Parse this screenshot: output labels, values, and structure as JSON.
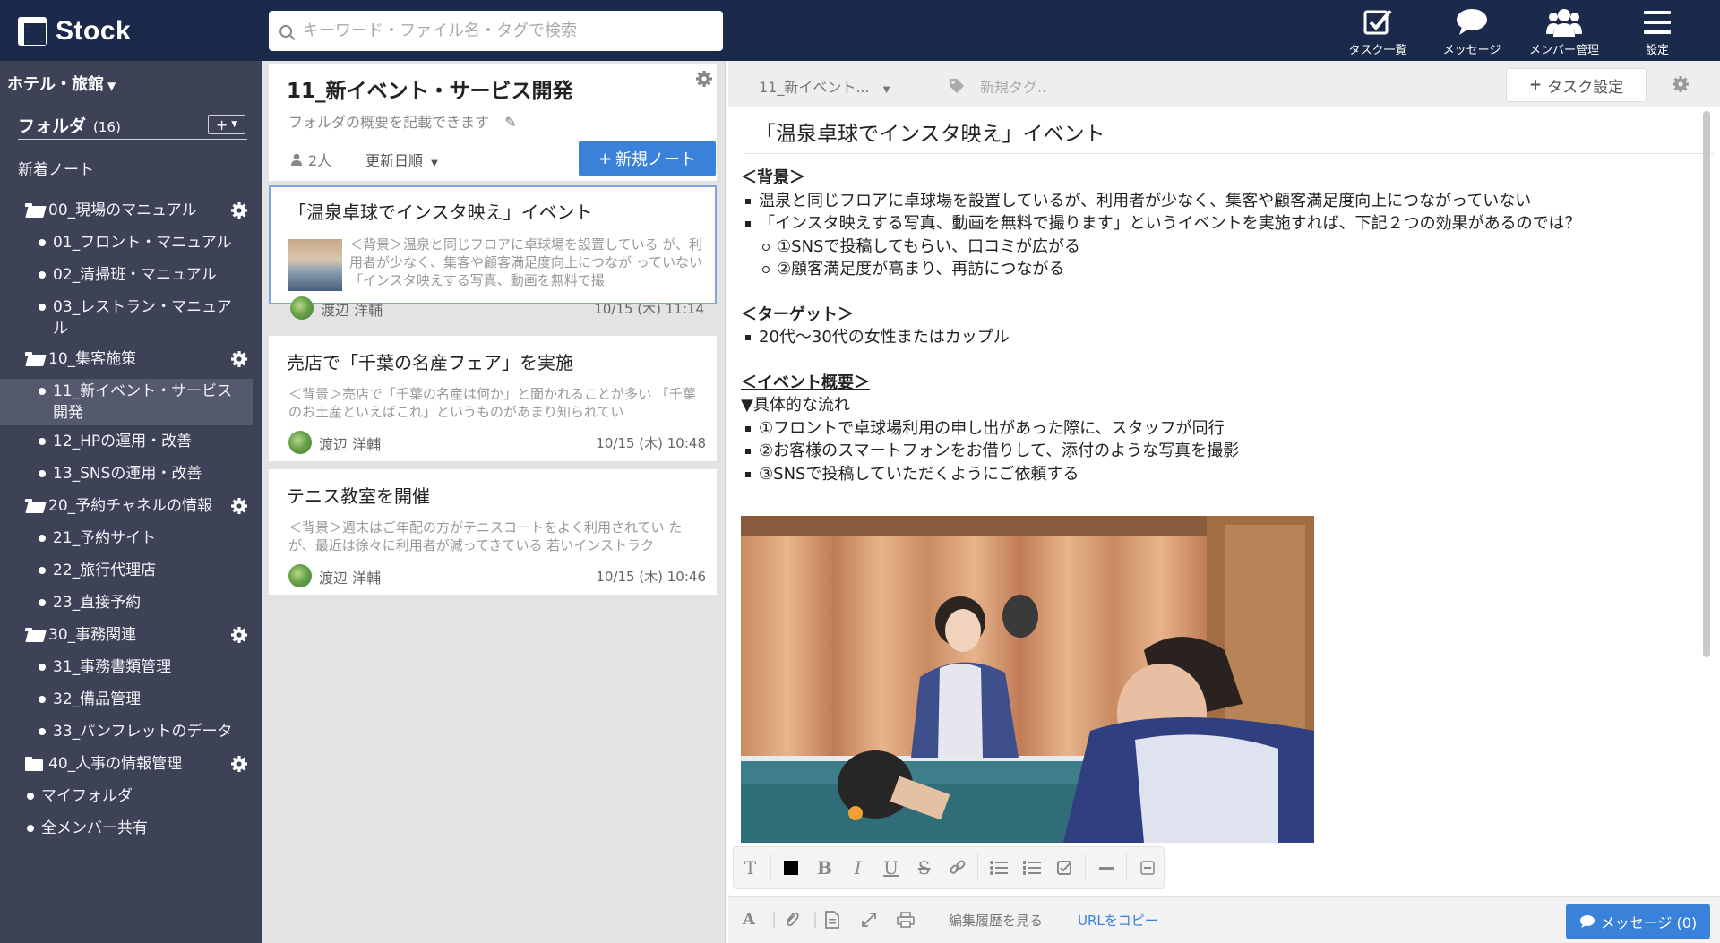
{
  "app": {
    "logo_text": "Stock",
    "brand_color": "#1b2a4a",
    "accent_color": "#3a82d9"
  },
  "search": {
    "placeholder": "キーワード・ファイル名・タグで検索"
  },
  "topnav": [
    {
      "label": "タスク一覧",
      "icon": "checkbox-icon"
    },
    {
      "label": "メッセージ",
      "icon": "speech-bubble-icon"
    },
    {
      "label": "メンバー管理",
      "icon": "members-icon"
    },
    {
      "label": "設定",
      "icon": "hamburger-icon"
    }
  ],
  "sidebar": {
    "company": "ホテル・旅館",
    "folder_header": "フォルダ",
    "folder_count": "(16)",
    "new_notes": "新着ノート",
    "items": [
      {
        "label": "00_現場のマニュアル",
        "type": "folder-open"
      },
      {
        "label": "01_フロント・マニュアル",
        "type": "sub"
      },
      {
        "label": "02_清掃班・マニュアル",
        "type": "sub"
      },
      {
        "label": "03_レストラン・マニュアル",
        "type": "sub"
      },
      {
        "label": "10_集客施策",
        "type": "folder-open"
      },
      {
        "label": "11_新イベント・サービス開発",
        "type": "sub",
        "selected": true
      },
      {
        "label": "12_HPの運用・改善",
        "type": "sub"
      },
      {
        "label": "13_SNSの運用・改善",
        "type": "sub"
      },
      {
        "label": "20_予約チャネルの情報",
        "type": "folder-open"
      },
      {
        "label": "21_予約サイト",
        "type": "sub"
      },
      {
        "label": "22_旅行代理店",
        "type": "sub"
      },
      {
        "label": "23_直接予約",
        "type": "sub"
      },
      {
        "label": "30_事務関連",
        "type": "folder-open"
      },
      {
        "label": "31_事務書類管理",
        "type": "sub"
      },
      {
        "label": "32_備品管理",
        "type": "sub"
      },
      {
        "label": "33_パンフレットのデータ",
        "type": "sub"
      },
      {
        "label": "40_人事の情報管理",
        "type": "folder-closed"
      },
      {
        "label": "マイフォルダ",
        "type": "root"
      },
      {
        "label": "全メンバー共有",
        "type": "root"
      }
    ]
  },
  "list": {
    "folder_title": "11_新イベント・サービス開発",
    "folder_desc": "フォルダの概要を記載できます",
    "members": "2人",
    "sort": "更新日順",
    "new_note": "新規ノート",
    "notes": [
      {
        "title": "「温泉卓球でインスタ映え」イベント",
        "snippet": "＜背景＞温泉と同じフロアに卓球場を設置している が、利用者が少なく、集客や顧客満足度向上につなが っていない 「インスタ映えする写真、動画を無料で撮",
        "author": "渡辺 洋輔",
        "date": "10/15 (木) 11:14"
      },
      {
        "title": "売店で「千葉の名産フェア」を実施",
        "snippet": "＜背景＞売店で「千葉の名産は何か」と聞かれることが多い 「千葉のお土産といえばこれ」というものがあまり知られてい",
        "author": "渡辺 洋輔",
        "date": "10/15 (木) 10:48"
      },
      {
        "title": "テニス教室を開催",
        "snippet": "＜背景＞週末はご年配の方がテニスコートをよく利用されてい たが、最近は徐々に利用者が減ってきている 若いインストラク",
        "author": "渡辺 洋輔",
        "date": "10/15 (木) 10:46"
      }
    ]
  },
  "editor": {
    "folder_crumb": "11_新イベント...",
    "tag_placeholder": "新規タグ..",
    "task_button": "タスク設定",
    "title": "「温泉卓球でインスタ映え」イベント",
    "h_background": "＜背景＞",
    "bg_1": "温泉と同じフロアに卓球場を設置しているが、利用者が少なく、集客や顧客満足度向上につながっていない",
    "bg_2": "「インスタ映えする写真、動画を無料で撮ります」というイベントを実施すれば、下記２つの効果があるのでは？",
    "bg_2a": "①SNSで投稿してもらい、口コミが広がる",
    "bg_2b": "②顧客満足度が高まり、再訪につながる",
    "h_target": "＜ターゲット＞",
    "target_1": "20代〜30代の女性またはカップル",
    "h_overview": "＜イベント概要＞",
    "flow_label": "▼具体的な流れ",
    "flow_1": "①フロントで卓球場利用の申し出があった際に、スタッフが同行",
    "flow_2": "②お客様のスマートフォンをお借りして、添付のような写真を撮影",
    "flow_3": "③SNSで投稿していただくようにご依頼する",
    "history_link": "編集履歴を見る",
    "copy_url": "URLをコピー",
    "message_button": "メッセージ (0)"
  }
}
